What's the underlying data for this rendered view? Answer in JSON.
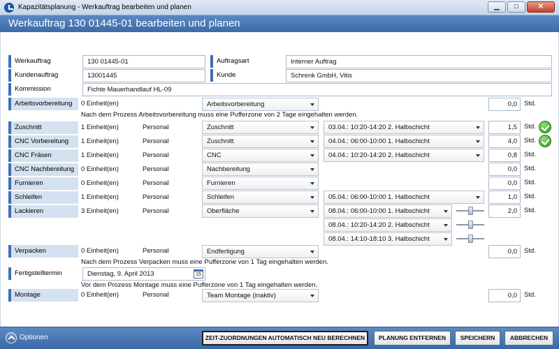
{
  "window": {
    "title": "Kapazitätsplanung - Werkauftrag bearbeiten und planen",
    "controls": {
      "minimize": "▁",
      "maximize": "□",
      "close": "✕"
    }
  },
  "header": {
    "title": "Werkauftrag 130 01445-01 bearbeiten und planen"
  },
  "info": {
    "werkauftrag": {
      "label": "Werkauftrag",
      "value": "130 01445-01"
    },
    "auftragsart": {
      "label": "Auftragsart",
      "value": "Interner Auftrag"
    },
    "kundenauftrag": {
      "label": "Kundenauftrag",
      "value": "13001445"
    },
    "kunde": {
      "label": "Kunde",
      "value": "Schrenk GmbH, Vitis"
    },
    "kommission": {
      "label": "Kommission",
      "value": "Fichte Mauerhandlauf HL-09"
    }
  },
  "processes": {
    "arbeitsvorbereitung": {
      "label": "Arbeitsvorbereitung",
      "einheiten": "0 Einheit(en)",
      "resource": "Arbeitsvorbereitung",
      "std": "0,0",
      "unit": "Std."
    },
    "note_av": "Nach dem Prozess Arbeitsvorbereitung muss eine Pufferzone von 2 Tage eingehalten werden.",
    "zuschnitt": {
      "label": "Zuschnitt",
      "einheiten": "1 Einheit(en)",
      "personal": "Personal",
      "resource": "Zuschnitt",
      "slot": "03.04.: 10:20-14:20 2. Halbschicht",
      "std": "1,5",
      "unit": "Std."
    },
    "cnc_vorbereitung": {
      "label": "CNC Vorbereitung",
      "einheiten": "1 Einheit(en)",
      "personal": "Personal",
      "resource": "Zuschnitt",
      "slot": "04.04.: 06:00-10:00 1. Halbschicht",
      "std": "4,0",
      "unit": "Std."
    },
    "cnc_fraesen": {
      "label": "CNC Fräsen",
      "einheiten": "1 Einheit(en)",
      "personal": "Personal",
      "resource": "CNC",
      "slot": "04.04.: 10:20-14:20 2. Halbschicht",
      "std": "0,8",
      "unit": "Std."
    },
    "cnc_nachbereitung": {
      "label": "CNC Nachbereitung",
      "einheiten": "0 Einheit(en)",
      "personal": "Personal",
      "resource": "Nachbereitung",
      "std": "0,0",
      "unit": "Std."
    },
    "furnieren": {
      "label": "Furnieren",
      "einheiten": "0 Einheit(en)",
      "personal": "Personal",
      "resource": "Furnieren",
      "std": "0,0",
      "unit": "Std."
    },
    "schleifen": {
      "label": "Schleifen",
      "einheiten": "1 Einheit(en)",
      "personal": "Personal",
      "resource": "Schleifen",
      "slot": "05.04.: 06:00-10:00 1. Halbschicht",
      "std": "1,0",
      "unit": "Std."
    },
    "lackieren": {
      "label": "Lackieren",
      "einheiten": "3 Einheit(en)",
      "personal": "Personal",
      "resource": "Oberfläche",
      "slots": [
        "08.04.: 06:00-10:00 1. Halbschicht",
        "08.04.: 10:20-14:20 2. Halbschicht",
        "08.04.: 14:10-18:10 3. Halbschicht"
      ],
      "slider_levels": [
        0.5,
        0.5,
        0.5
      ],
      "std": "2,0",
      "unit": "Std."
    },
    "verpacken": {
      "label": "Verpacken",
      "einheiten": "0 Einheit(en)",
      "personal": "Personal",
      "resource": "Endfertigung",
      "std": "0,0",
      "unit": "Std."
    },
    "note_verpacken": "Nach dem Prozess Verpacken muss eine Pufferzone von 1 Tag eingehalten werden.",
    "fertigstelltermin": {
      "label": "Fertigstelltermin",
      "value": "Dienstag, 9. April 2013",
      "cal_day": "15"
    },
    "note_montage": "Vor dem Prozess Montage muss eine Pufferzone von 1 Tag eingehalten werden.",
    "montage": {
      "label": "Montage",
      "einheiten": "0 Einheit(en)",
      "personal": "Personal",
      "resource": "Team Montage (inaktiv)",
      "std": "0,0",
      "unit": "Std."
    }
  },
  "footer": {
    "options": "Optionen",
    "btn_recalc": "ZEIT-ZUORDNUNGEN AUTOMATISCH NEU BERECHNEN",
    "btn_remove": "PLANUNG ENTFERNEN",
    "btn_save": "SPEICHERN",
    "btn_cancel": "ABBRECHEN"
  },
  "colors": {
    "accent": "#3e6fb3",
    "label_bg": "#d4e1f1",
    "check": "#2f9a24"
  }
}
